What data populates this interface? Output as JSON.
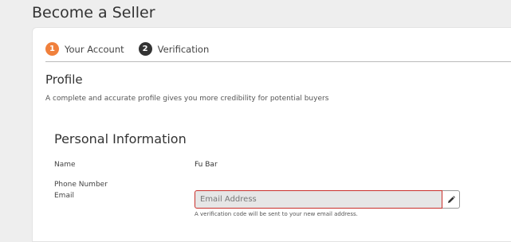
{
  "page": {
    "title": "Become a Seller"
  },
  "steps": [
    {
      "number": "1",
      "label": "Your Account",
      "color": "#f0803c"
    },
    {
      "number": "2",
      "label": "Verification",
      "color": "#333333"
    }
  ],
  "profile": {
    "title": "Profile",
    "subtitle": "A complete and accurate profile gives you more credibility for potential buyers"
  },
  "personal_info": {
    "title": "Personal Information",
    "name_label": "Name",
    "name_value": "Fu Bar",
    "phone_label": "Phone Number",
    "phone_value": "",
    "email_label": "Email",
    "email_value": "",
    "email_placeholder": "Email Address",
    "email_edit_icon": "pencil-icon",
    "email_help": "A verification code will be sent to your new email address."
  },
  "colors": {
    "accent": "#f0803c",
    "error_border": "#c9302c"
  }
}
